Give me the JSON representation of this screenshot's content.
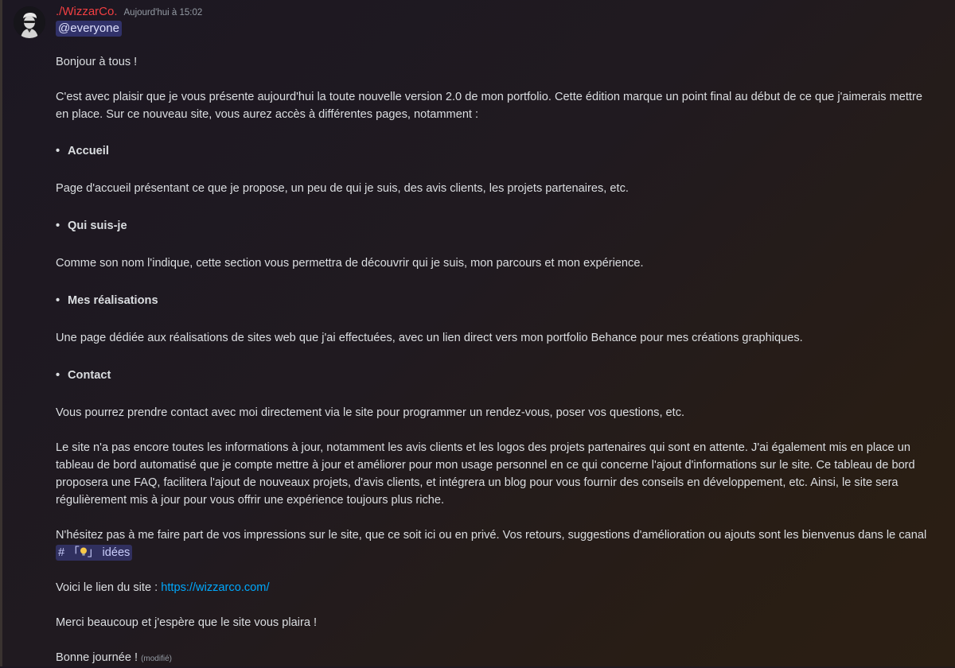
{
  "author": {
    "name": "./WizzarCo.",
    "timestamp": "Aujourd'hui à 15:02",
    "avatar_icon": "avatar-icon",
    "name_color": "#f23f42"
  },
  "mention": "@everyone",
  "greeting": "Bonjour à tous !",
  "intro": "C'est avec plaisir que je vous présente aujourd'hui la toute nouvelle version 2.0 de mon portfolio. Cette édition marque un point final au début de ce que j'aimerais mettre en place. Sur ce nouveau site, vous aurez accès à différentes pages, notamment :",
  "bullet_char": "•",
  "sections": [
    {
      "title": "Accueil",
      "text": "Page d'accueil présentant ce que je propose, un peu de qui je suis, des avis clients, les projets partenaires, etc."
    },
    {
      "title": "Qui suis-je",
      "text": "Comme son nom l'indique, cette section vous permettra de découvrir qui je suis, mon parcours et mon expérience."
    },
    {
      "title": "Mes réalisations",
      "text": "Une page dédiée aux réalisations de sites web que j'ai effectuées, avec un lien direct vers mon portfolio Behance pour mes créations graphiques."
    },
    {
      "title": "Contact",
      "text": "Vous pourrez prendre contact avec moi directement via le site pour programmer un rendez-vous, poser vos questions, etc."
    }
  ],
  "status_paragraph": "Le site n'a pas encore toutes les informations à jour, notamment les avis clients et les logos des projets partenaires qui sont en attente. J'ai également mis en place un tableau de bord automatisé que je compte mettre à jour et améliorer pour mon usage personnel en ce qui concerne l'ajout d'informations sur le site. Ce tableau de bord proposera une FAQ, facilitera l'ajout de nouveaux projets, d'avis clients, et intégrera un blog pour vous fournir des conseils en développement, etc. Ainsi, le site sera régulièrement mis à jour pour vous offrir une expérience toujours plus riche.",
  "feedback_paragraph": "N'hésitez pas à me faire part de vos impressions sur le site, que ce soit ici ou en privé. Vos retours, suggestions d'amélioration ou ajouts sont les bienvenus dans le canal",
  "channel": {
    "hash": "#",
    "open_bracket": "「",
    "icon": "lightbulb-icon",
    "close_bracket": "」",
    "name": "idées"
  },
  "link_line": {
    "label": "Voici le lien du site :",
    "url": "https://wizzarco.com/"
  },
  "thanks": "Merci beaucoup et j'espère que le site vous plaira !",
  "signoff": "Bonne journée !",
  "edited_label": "(modifié)",
  "colors": {
    "mention_bg": "#5865f2",
    "link": "#00a8fc",
    "text": "#dbdee1",
    "muted": "#949ba4"
  }
}
